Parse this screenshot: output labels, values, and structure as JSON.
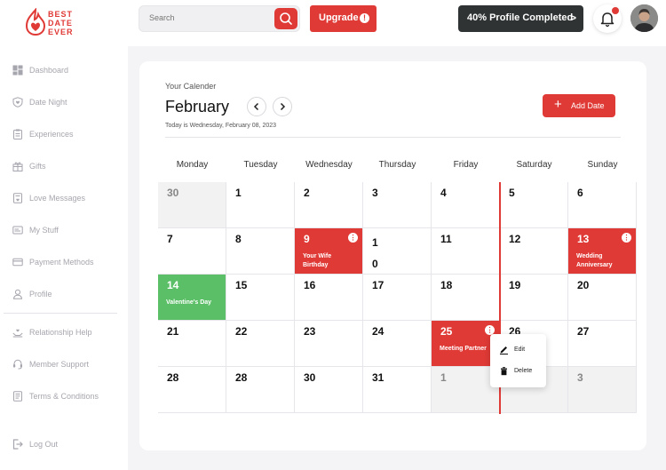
{
  "brand": {
    "line1": "BEST",
    "line2": "DATE",
    "line3": "EVER",
    "color": "#e03a36"
  },
  "header": {
    "search_placeholder": "Search",
    "upgrade_label": "Upgrade",
    "upgrade_badge": "!",
    "profile_label": "40% Profile Completed",
    "profile_progress": 40,
    "profile_chevron": ">"
  },
  "sidebar": {
    "items": [
      {
        "label": "Dashboard",
        "icon": "dashboard-icon"
      },
      {
        "label": "Date Night",
        "icon": "shield-heart-icon"
      },
      {
        "label": "Experiences",
        "icon": "clipboard-icon"
      },
      {
        "label": "Gifts",
        "icon": "gift-icon"
      },
      {
        "label": "Love Messages",
        "icon": "message-icon"
      },
      {
        "label": "My Stuff",
        "icon": "folder-icon"
      },
      {
        "label": "Payment Methods",
        "icon": "credit-card-icon"
      },
      {
        "label": "Profile",
        "icon": "user-icon"
      },
      {
        "label": "Relationship Help",
        "icon": "hands-heart-icon"
      },
      {
        "label": "Member Support",
        "icon": "headset-icon"
      },
      {
        "label": "Terms & Conditions",
        "icon": "document-icon"
      },
      {
        "label": "Log Out",
        "icon": "logout-icon"
      }
    ]
  },
  "calendar": {
    "heading": "Your Calender",
    "month": "February",
    "today_text": "Today is Wednesday, February 08, 2023",
    "add_label": "Add Date",
    "weekdays": [
      "Monday",
      "Tuesday",
      "Wednesday",
      "Thursday",
      "Friday",
      "Saturday",
      "Sunday"
    ],
    "weeks": [
      [
        {
          "day": "30",
          "muted": true
        },
        {
          "day": "1"
        },
        {
          "day": "2"
        },
        {
          "day": "3"
        },
        {
          "day": "4"
        },
        {
          "day": "5"
        },
        {
          "day": "6"
        }
      ],
      [
        {
          "day": "7"
        },
        {
          "day": "8"
        },
        {
          "day": "9",
          "event": "Your Wife Birthday"
        },
        {
          "day": "1",
          "day2": "0"
        },
        {
          "day": "11"
        },
        {
          "day": "12"
        },
        {
          "day": "13",
          "event": "Wedding Anniversary"
        }
      ],
      [
        {
          "day": "14",
          "event": "Valentine's Day"
        },
        {
          "day": "15"
        },
        {
          "day": "16"
        },
        {
          "day": "17"
        },
        {
          "day": "18"
        },
        {
          "day": "19"
        },
        {
          "day": "20"
        }
      ],
      [
        {
          "day": "21"
        },
        {
          "day": "22"
        },
        {
          "day": "23"
        },
        {
          "day": "24"
        },
        {
          "day": "25",
          "event": "Meeting Partner"
        },
        {
          "day": "26"
        },
        {
          "day": "27"
        }
      ],
      [
        {
          "day": "28"
        },
        {
          "day": "28"
        },
        {
          "day": "30"
        },
        {
          "day": "31"
        },
        {
          "day": "1",
          "muted": true
        },
        {
          "day": "2",
          "muted": true
        },
        {
          "day": "3",
          "muted": true
        }
      ]
    ]
  },
  "popup": {
    "edit_label": "Edit",
    "delete_label": "Delete"
  },
  "colors": {
    "accent": "#e03a36",
    "green": "#5bbf67",
    "dark": "#2f3333"
  }
}
